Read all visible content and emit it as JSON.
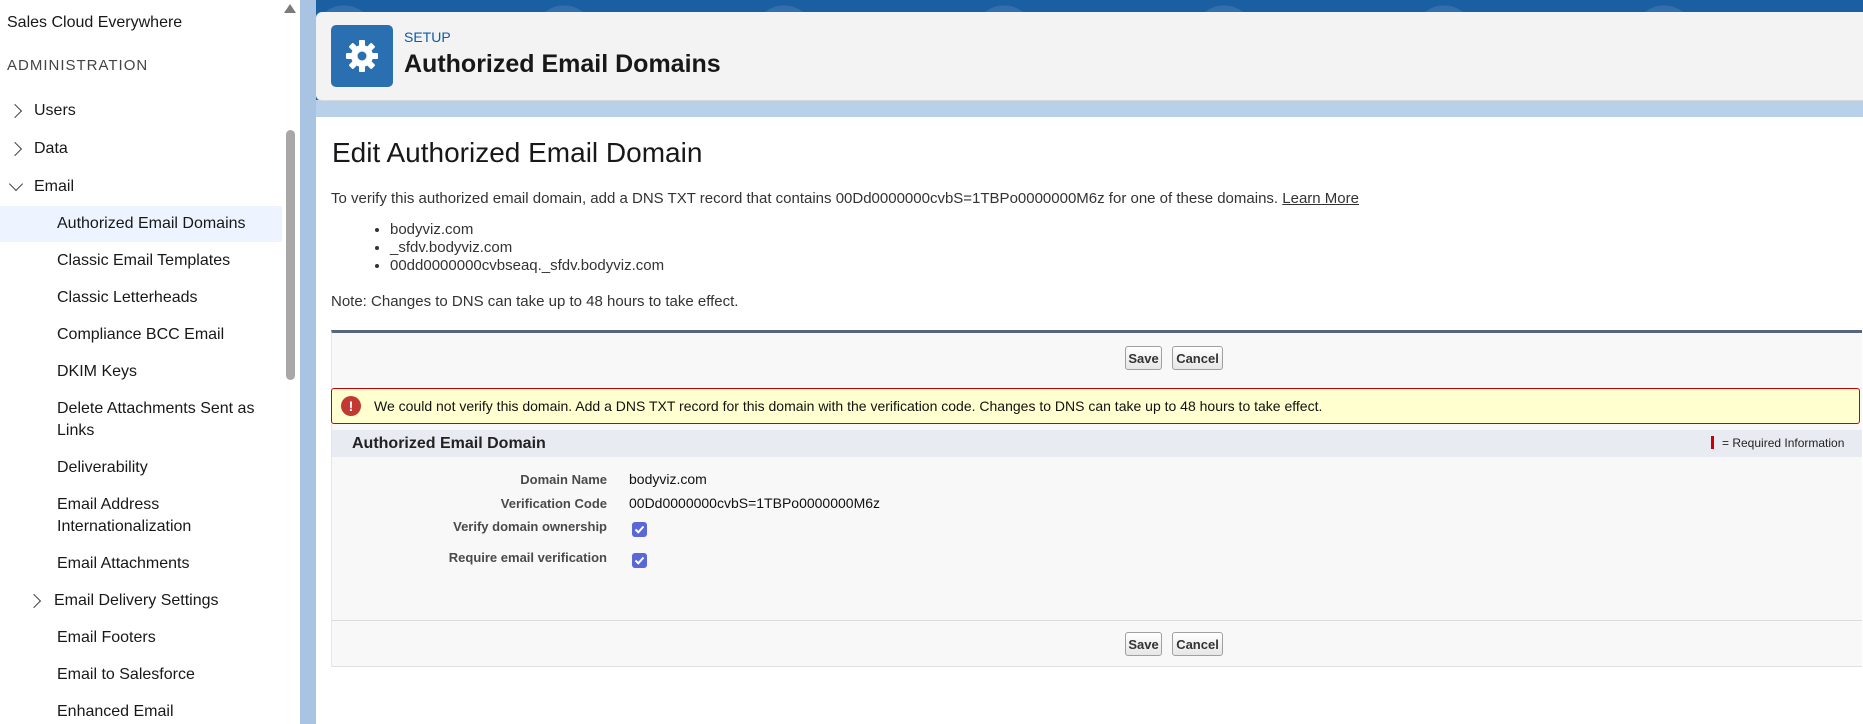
{
  "sidebar": {
    "top_item": "Sales Cloud Everywhere",
    "section_label": "ADMINISTRATION",
    "groups": {
      "users": "Users",
      "data": "Data",
      "email": "Email"
    },
    "email_items": [
      "Authorized Email Domains",
      "Classic Email Templates",
      "Classic Letterheads",
      "Compliance BCC Email",
      "DKIM Keys",
      "Delete Attachments Sent as Links",
      "Deliverability",
      "Email Address Internationalization",
      "Email Attachments",
      "Email Delivery Settings",
      "Email Footers",
      "Email to Salesforce",
      "Enhanced Email"
    ]
  },
  "header": {
    "setup_label": "SETUP",
    "title": "Authorized Email Domains"
  },
  "content": {
    "heading": "Edit Authorized Email Domain",
    "verify_text": "To verify this authorized email domain, add a DNS TXT record that contains 00Dd0000000cvbS=1TBPo0000000M6z for one of these domains.",
    "learn_more": "Learn More",
    "domains": [
      "bodyviz.com",
      "_sfdv.bodyviz.com",
      "00dd0000000cvbseaq._sfdv.bodyviz.com"
    ],
    "note": "Note: Changes to DNS can take up to 48 hours to take effect."
  },
  "form": {
    "save_label": "Save",
    "cancel_label": "Cancel",
    "error_message": "We could not verify this domain. Add a DNS TXT record for this domain with the verification code. Changes to DNS can take up to 48 hours to take effect.",
    "section_title": "Authorized Email Domain",
    "required_info": "= Required Information",
    "fields": {
      "domain_name_label": "Domain Name",
      "domain_name_value": "bodyviz.com",
      "verification_code_label": "Verification Code",
      "verification_code_value": "00Dd0000000cvbS=1TBPo0000000M6z",
      "verify_ownership_label": "Verify domain ownership",
      "verify_ownership_checked": true,
      "require_verification_label": "Require email verification",
      "require_verification_checked": true
    }
  },
  "colors": {
    "header_icon_bg": "#2a6fb0",
    "setup_link": "#0b5cab",
    "error_bg": "#ffffd0",
    "error_border": "#cc0000",
    "checkbox": "#5a67d8"
  },
  "icons": {
    "header": "gear-icon",
    "error": "error-icon",
    "nav_collapsed": "chevron-right-icon",
    "nav_expanded": "chevron-down-icon"
  }
}
